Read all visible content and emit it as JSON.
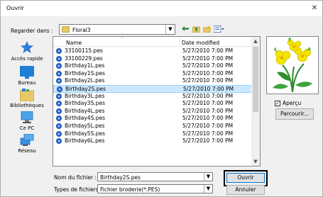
{
  "window": {
    "title": "Ouvrir",
    "close_glyph": "✕"
  },
  "look_in": {
    "label": "Regarder dans :",
    "value": "Floral3"
  },
  "toolbar": {
    "icons": [
      "back-arrow-icon",
      "up-folder-icon",
      "new-folder-icon",
      "view-menu-icon"
    ]
  },
  "places": [
    {
      "label": "Accès rapide",
      "icon": "star-icon"
    },
    {
      "label": "Bureau",
      "icon": "desktop-icon"
    },
    {
      "label": "Bibliothèques",
      "icon": "libraries-icon"
    },
    {
      "label": "Ce PC",
      "icon": "computer-icon"
    },
    {
      "label": "Réseau",
      "icon": "network-icon"
    }
  ],
  "file_list": {
    "columns": {
      "name": "Name",
      "date": "Date modified"
    },
    "rows": [
      {
        "name": "33100115.pes",
        "date": "5/27/2010 7:00 PM",
        "selected": false
      },
      {
        "name": "33100229.pes",
        "date": "5/27/2010 7:00 PM",
        "selected": false
      },
      {
        "name": "Birthday1L.pes",
        "date": "5/27/2010 7:00 PM",
        "selected": false
      },
      {
        "name": "Birthday1S.pes",
        "date": "5/27/2010 7:00 PM",
        "selected": false
      },
      {
        "name": "Birthday2L.pes",
        "date": "5/27/2010 7:00 PM",
        "selected": false
      },
      {
        "name": "Birthday2S.pes",
        "date": "5/27/2010 7:00 PM",
        "selected": true
      },
      {
        "name": "Birthday3L.pes",
        "date": "5/27/2010 7:00 PM",
        "selected": false
      },
      {
        "name": "Birthday3S.pes",
        "date": "5/27/2010 7:00 PM",
        "selected": false
      },
      {
        "name": "Birthday4L.pes",
        "date": "5/27/2010 7:00 PM",
        "selected": false
      },
      {
        "name": "Birthday4S.pes",
        "date": "5/27/2010 7:00 PM",
        "selected": false
      },
      {
        "name": "Birthday5L.pes",
        "date": "5/27/2010 7:00 PM",
        "selected": false
      },
      {
        "name": "Birthday5S.pes",
        "date": "5/27/2010 7:00 PM",
        "selected": false
      },
      {
        "name": "Birthday6L.pes",
        "date": "5/27/2010 7:00 PM",
        "selected": false
      }
    ]
  },
  "preview": {
    "checkbox_label": "Aperçu",
    "checked": true,
    "browse_label": "Parcourir..."
  },
  "filename": {
    "label": "Nom du fichier :",
    "value": "Birthday2S.pes"
  },
  "filetype": {
    "label": "Types de fichiers :",
    "value": "Fichier broderie(*.PES)"
  },
  "buttons": {
    "open": "Ouvrir",
    "cancel": "Annuler"
  },
  "colors": {
    "selection": "#cce8ff",
    "accent": "#0078d7",
    "file_icon": "#2f6fd6"
  }
}
